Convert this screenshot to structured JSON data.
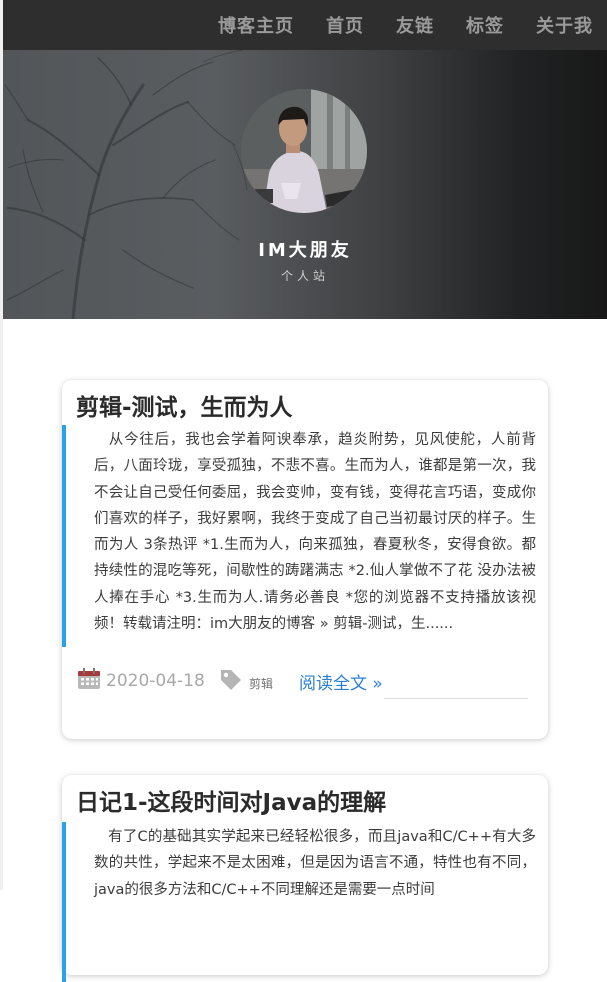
{
  "nav": {
    "items": [
      "博客主页",
      "首页",
      "友链",
      "标签",
      "关于我"
    ]
  },
  "hero": {
    "site_name": "IM大朋友",
    "subtitle": "个人站"
  },
  "posts": [
    {
      "title": "剪辑-测试，生而为人",
      "excerpt": "从今往后，我也会学着阿谀奉承，趋炎附势，见风使舵，人前背后，八面玲珑，享受孤独，不悲不喜。生而为人，谁都是第一次，我不会让自己受任何委屈，我会变帅，变有钱，变得花言巧语，变成你们喜欢的样子，我好累啊，我终于变成了自己当初最讨厌的样子。生而为人 3条热评 *1.生而为人，向来孤独，春夏秋冬，安得食欲。都持续性的混吃等死，间歇性的踌躇满志 *2.仙人掌做不了花 没办法被人捧在手心 *3.生而为人.请务必善良 *您的浏览器不支持播放该视频！转载请注明：im大朋友的博客 » 剪辑-测试，生......",
      "date": "2020-04-18",
      "tag": "剪辑",
      "read_more": "阅读全文 »"
    },
    {
      "title": "日记1-这段时间对Java的理解",
      "excerpt": "有了C的基础其实学起来已经轻松很多，而且java和C/C++有大多数的共性，学起来不是太困难，但是因为语言不通，特性也有不同，java的很多方法和C/C++不同理解还是需要一点时间"
    }
  ],
  "colors": {
    "navbar_bg": "#2e2e2e",
    "accent_border": "#2aa3e6",
    "link": "#2b7fd3"
  }
}
